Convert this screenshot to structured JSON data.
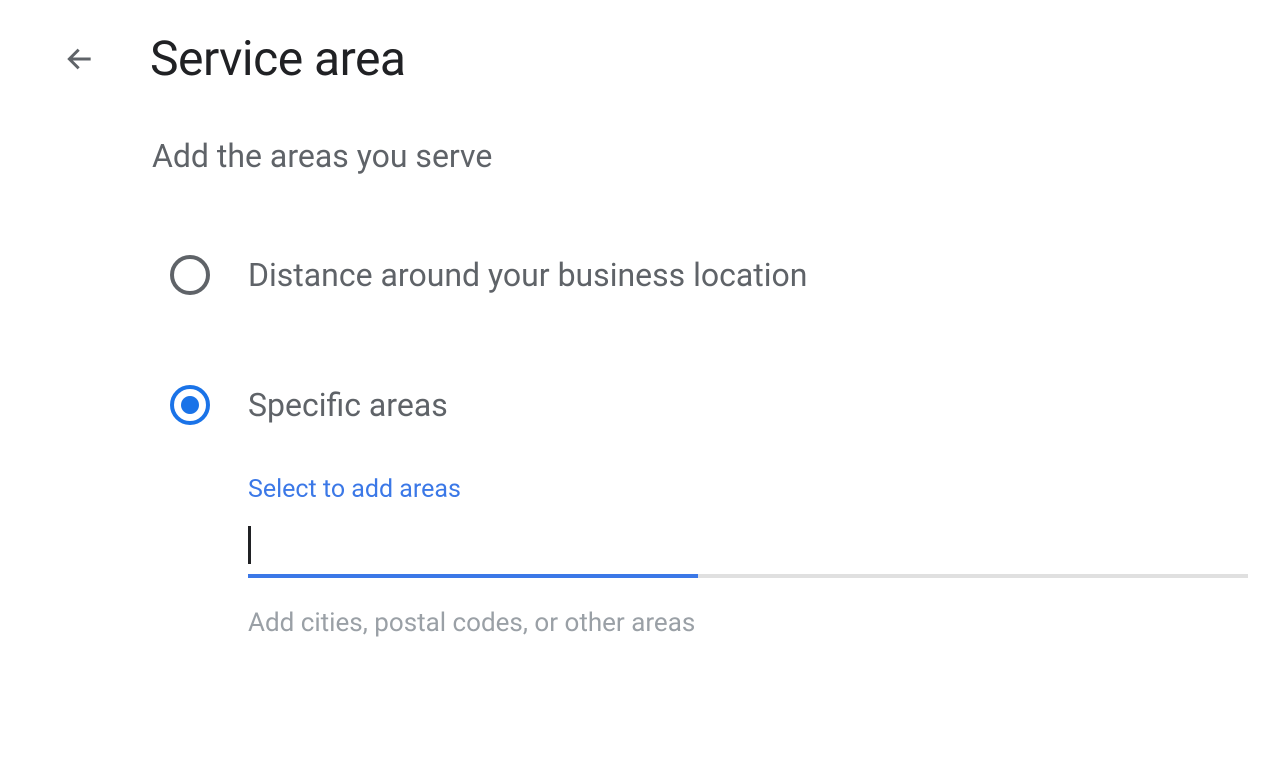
{
  "header": {
    "title": "Service area"
  },
  "subtitle": "Add the areas you serve",
  "radio_options": {
    "distance": {
      "label": "Distance around your business location",
      "selected": false
    },
    "specific": {
      "label": "Specific areas",
      "selected": true
    }
  },
  "input": {
    "floating_label": "Select to add areas",
    "value": "",
    "helper": "Add cities, postal codes, or other areas"
  }
}
